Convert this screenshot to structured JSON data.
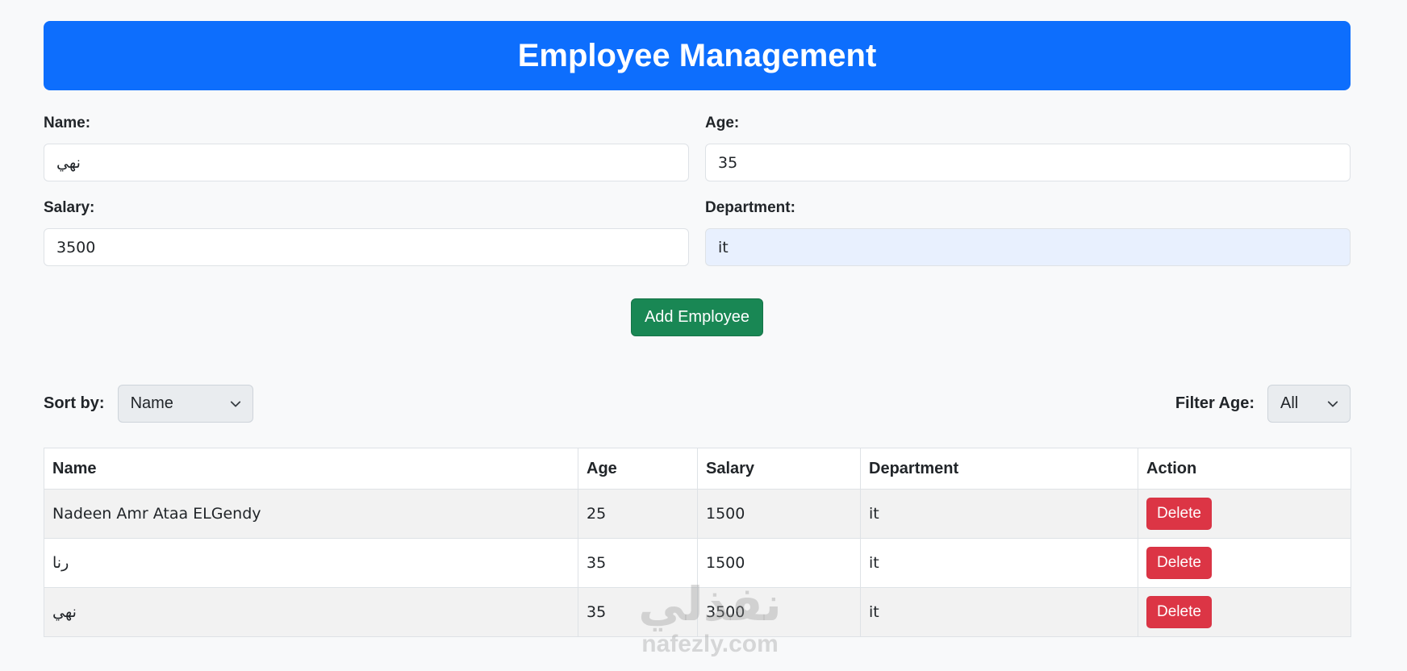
{
  "header": {
    "title": "Employee Management"
  },
  "form": {
    "name": {
      "label": "Name:",
      "value": "نهي"
    },
    "age": {
      "label": "Age:",
      "value": "35"
    },
    "salary": {
      "label": "Salary:",
      "value": "3500"
    },
    "department": {
      "label": "Department:",
      "value": "it"
    },
    "add_button": "Add Employee"
  },
  "controls": {
    "sort_label": "Sort by:",
    "sort_value": "Name",
    "filter_label": "Filter Age:",
    "filter_value": "All"
  },
  "table": {
    "columns": [
      "Name",
      "Age",
      "Salary",
      "Department",
      "Action"
    ],
    "rows": [
      {
        "name": "Nadeen Amr Ataa ELGendy",
        "age": "25",
        "salary": "1500",
        "department": "it",
        "action": "Delete"
      },
      {
        "name": "رنا",
        "age": "35",
        "salary": "1500",
        "department": "it",
        "action": "Delete"
      },
      {
        "name": "نهي",
        "age": "35",
        "salary": "3500",
        "department": "it",
        "action": "Delete"
      }
    ]
  },
  "watermark": {
    "arabic": "نفذلي",
    "latin": "nafezly.com"
  },
  "colors": {
    "primary": "#0d6efd",
    "success": "#198754",
    "danger": "#dc3545"
  }
}
